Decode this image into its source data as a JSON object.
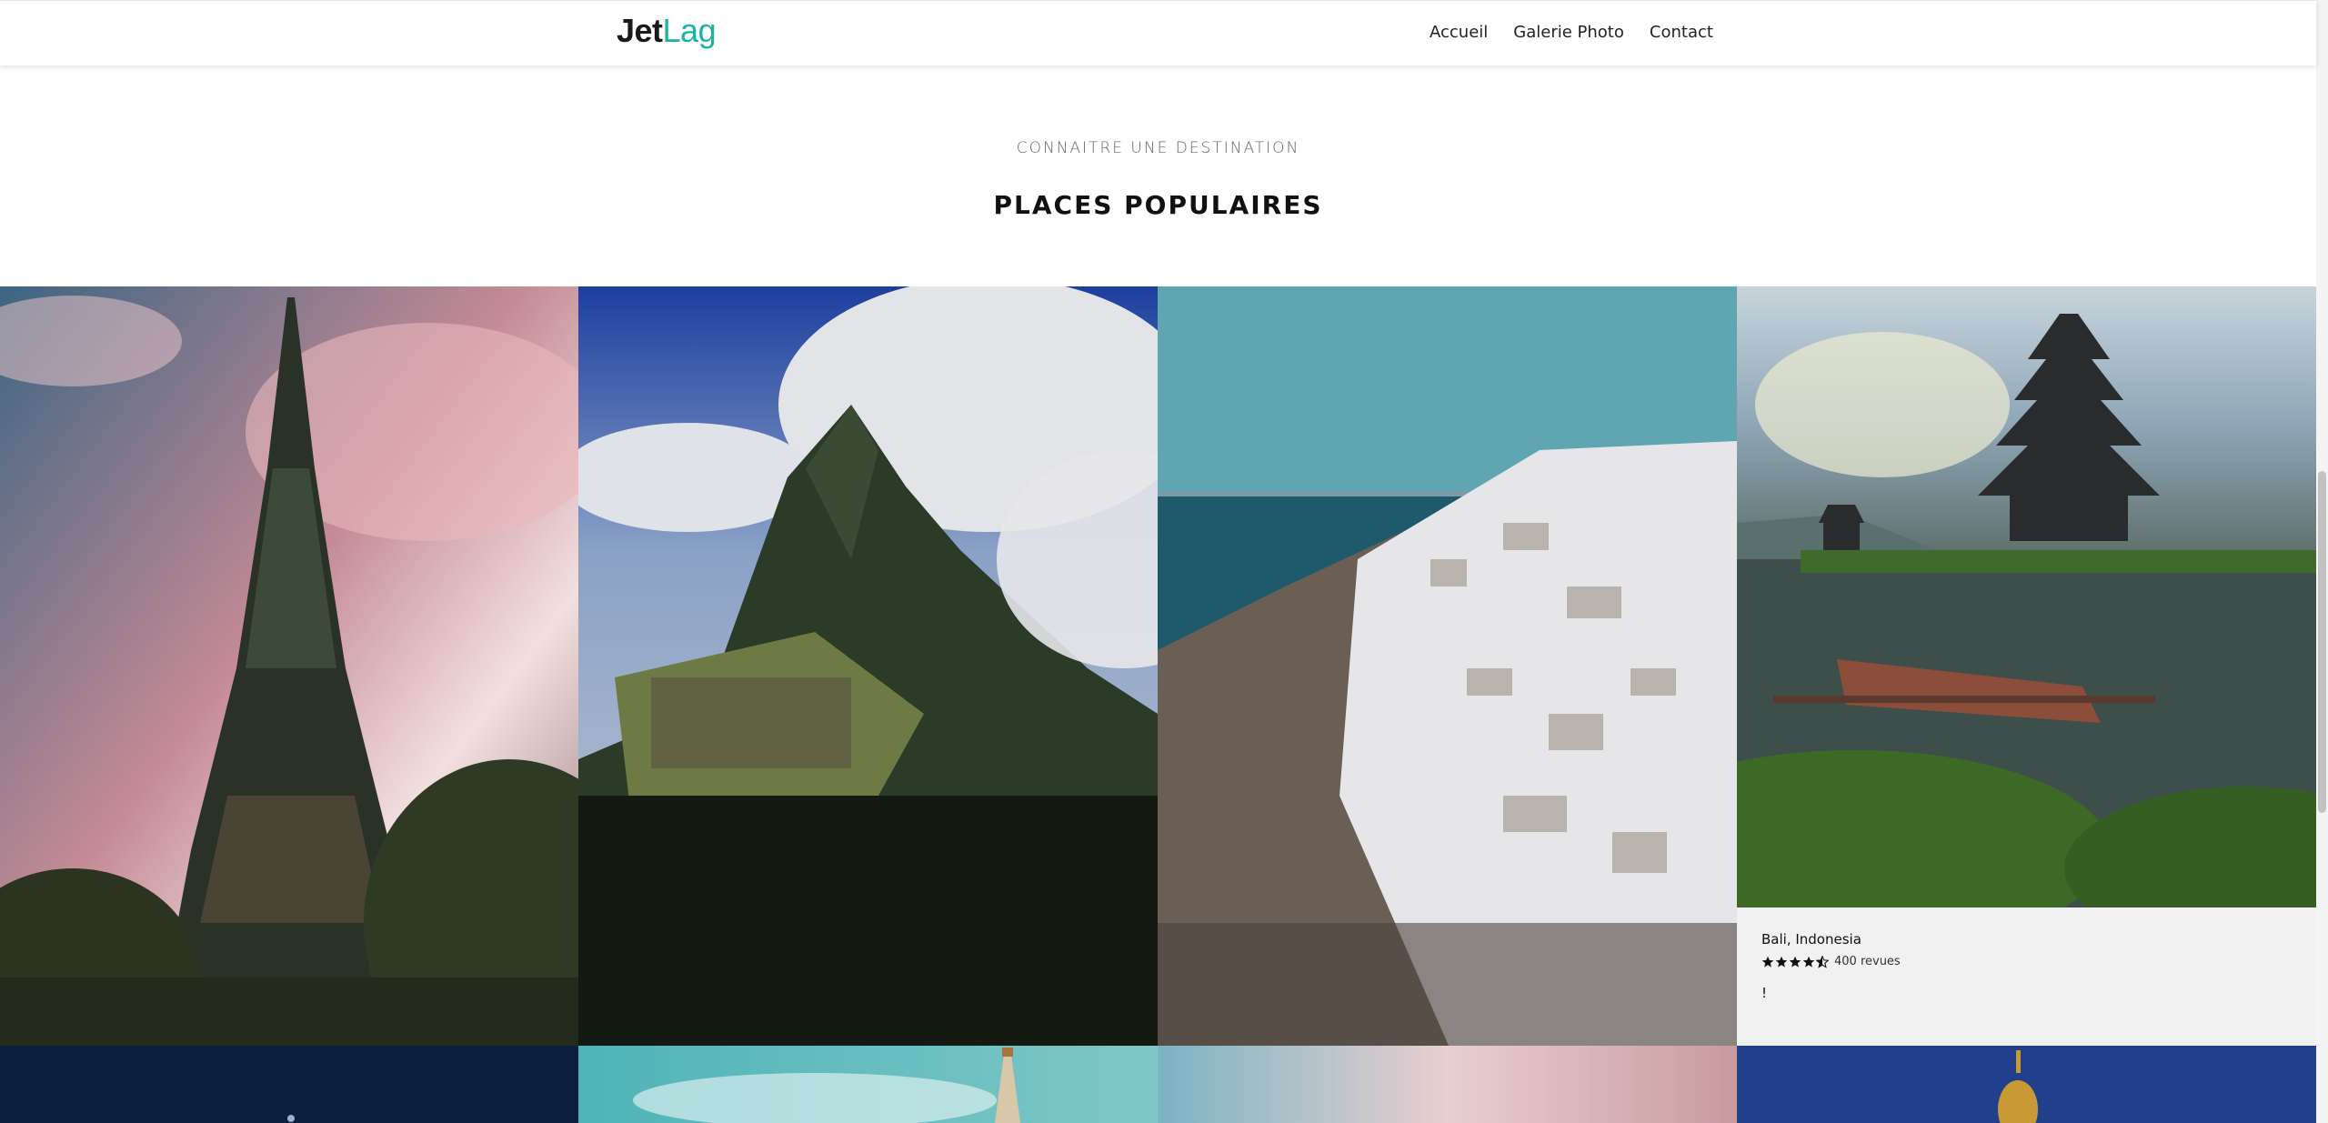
{
  "header": {
    "logo_part1": "Jet",
    "logo_part2": "Lag",
    "nav": [
      "Accueil",
      "Galerie Photo",
      "Contact"
    ]
  },
  "section": {
    "subtitle": "CONNAITRE UNE DESTINATION",
    "title": "PLACES POPULAIRES"
  },
  "featured_caption": {
    "place": "Bali, Indonesia",
    "rating": 4.5,
    "reviews": "400 revues",
    "note": "!"
  },
  "gallery": {
    "tiles": [
      {
        "name": "eiffel-tower-photo"
      },
      {
        "name": "machu-picchu-photo"
      },
      {
        "name": "santorini-photo"
      },
      {
        "name": "bali-temple-photo"
      },
      {
        "name": "night-city-photo"
      },
      {
        "name": "stupa-photo"
      },
      {
        "name": "pink-sky-photo"
      },
      {
        "name": "golden-dome-photo"
      }
    ]
  },
  "colors": {
    "brand_accent": "#1ab3a6",
    "caption_bg": "#f1f1f1"
  }
}
